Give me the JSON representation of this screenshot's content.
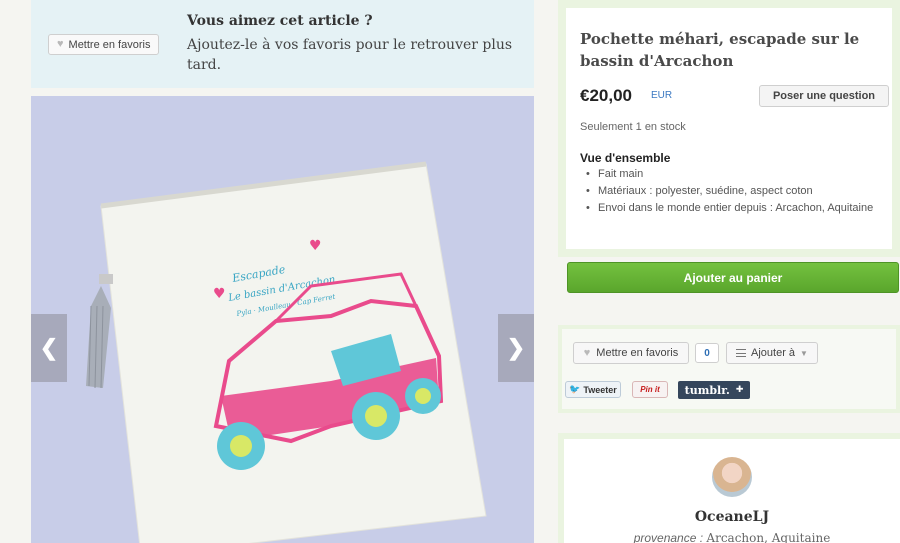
{
  "favorites_banner": {
    "button_label": "Mettre en favoris",
    "title": "Vous aimez cet article ?",
    "text": "Ajoutez-le à vos favoris pour le retrouver plus tard."
  },
  "gallery": {
    "prev_label": "❮",
    "next_label": "❯",
    "image_texts": {
      "line1": "Escapade",
      "line2": "Le bassin d'Arcachon",
      "line3": "Pyla · Moulleau · Cap Ferret"
    }
  },
  "product": {
    "title": "Pochette méhari, escapade sur le bassin d'Arcachon",
    "price": "€20,00",
    "currency": "EUR",
    "question_button": "Poser une question",
    "stock": "Seulement 1 en stock",
    "overview_title": "Vue d'ensemble",
    "overview_items": [
      "Fait main",
      "Matériaux : polyester, suédine, aspect coton",
      "Envoi dans le monde entier depuis : Arcachon, Aquitaine"
    ]
  },
  "cart": {
    "button_label": "Ajouter au panier"
  },
  "social": {
    "favorite_label": "Mettre en favoris",
    "favorite_count": "0",
    "add_to_label": "Ajouter à",
    "tweet_label": "Tweeter",
    "pin_label": "Pin it",
    "tumblr_label": "tumblr.",
    "tumblr_plus": "✚"
  },
  "shop": {
    "name": "OceaneLJ",
    "origin_label": "provenance :",
    "origin_value": "Arcachon, Aquitaine"
  },
  "colors": {
    "banner_bg": "#e5f2f5",
    "panel_bg": "#eaf4e0",
    "cart_green": "#5aa62c",
    "photo_bg": "#c8cde8",
    "car_pink": "#e94b8c",
    "wheel_cyan": "#5fc7d8",
    "tumblr_navy": "#35465c"
  }
}
